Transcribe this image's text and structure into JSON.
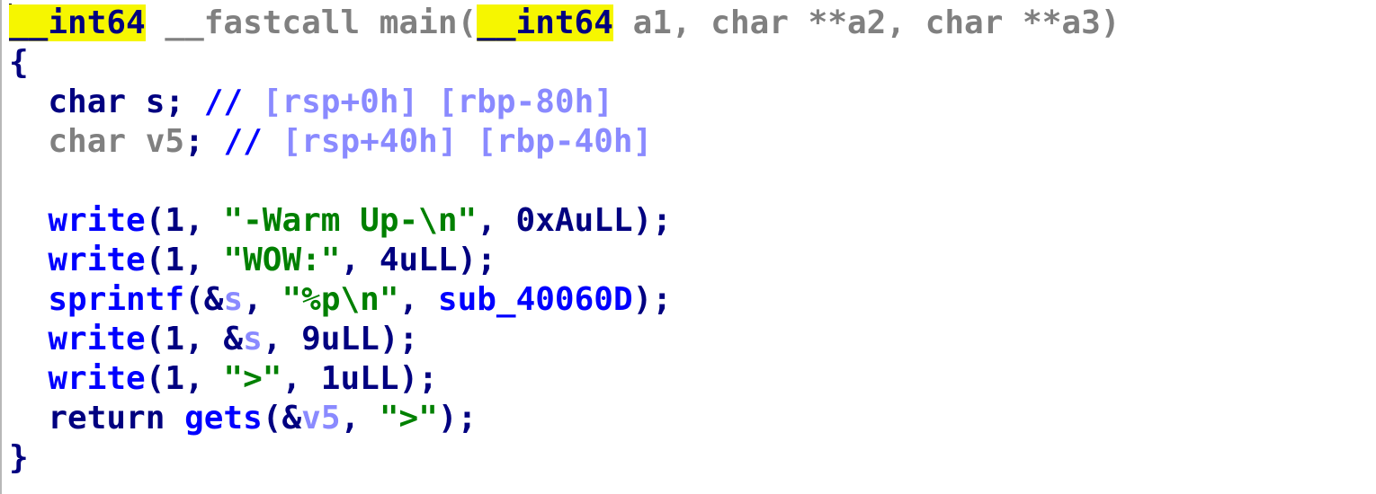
{
  "window": {
    "title": ""
  },
  "code": {
    "lines": [
      [
        {
          "t": "__int64",
          "c": "k",
          "hl": true
        },
        {
          "t": " __fastcall main(",
          "c": "g"
        },
        {
          "t": "__int64",
          "c": "k",
          "hl": true
        },
        {
          "t": " a1, char **a2, char **a3)",
          "c": "g"
        }
      ],
      [
        {
          "t": "{",
          "c": "k"
        }
      ],
      [
        {
          "t": "  char s; ",
          "c": "k"
        },
        {
          "t": "// ",
          "c": "f"
        },
        {
          "t": "[rsp+0h] [rbp-80h]",
          "c": "c"
        }
      ],
      [
        {
          "t": "  char v5",
          "c": "g"
        },
        {
          "t": "; ",
          "c": "k"
        },
        {
          "t": "// ",
          "c": "f"
        },
        {
          "t": "[rsp+40h] [rbp-40h]",
          "c": "c"
        }
      ],
      [],
      [
        {
          "t": "  write",
          "c": "f"
        },
        {
          "t": "(1, ",
          "c": "k"
        },
        {
          "t": "\"-Warm Up-\\n\"",
          "c": "s"
        },
        {
          "t": ", 0xAuLL);",
          "c": "k"
        }
      ],
      [
        {
          "t": "  write",
          "c": "f"
        },
        {
          "t": "(1, ",
          "c": "k"
        },
        {
          "t": "\"WOW:\"",
          "c": "s"
        },
        {
          "t": ", 4uLL);",
          "c": "k"
        }
      ],
      [
        {
          "t": "  sprintf",
          "c": "f"
        },
        {
          "t": "(&",
          "c": "k"
        },
        {
          "t": "s",
          "c": "c"
        },
        {
          "t": ", ",
          "c": "k"
        },
        {
          "t": "\"%p\\n\"",
          "c": "s"
        },
        {
          "t": ", ",
          "c": "k"
        },
        {
          "t": "sub_40060D",
          "c": "f"
        },
        {
          "t": ");",
          "c": "k"
        }
      ],
      [
        {
          "t": "  write",
          "c": "f"
        },
        {
          "t": "(1, &",
          "c": "k"
        },
        {
          "t": "s",
          "c": "c"
        },
        {
          "t": ", 9uLL);",
          "c": "k"
        }
      ],
      [
        {
          "t": "  write",
          "c": "f"
        },
        {
          "t": "(1, ",
          "c": "k"
        },
        {
          "t": "\">\"",
          "c": "s"
        },
        {
          "t": ", 1uLL);",
          "c": "k"
        }
      ],
      [
        {
          "t": "  return ",
          "c": "k"
        },
        {
          "t": "gets",
          "c": "f"
        },
        {
          "t": "(&",
          "c": "k"
        },
        {
          "t": "v5",
          "c": "c"
        },
        {
          "t": ", ",
          "c": "k"
        },
        {
          "t": "\">\"",
          "c": "s"
        },
        {
          "t": ");",
          "c": "k"
        }
      ],
      [
        {
          "t": "}",
          "c": "k"
        }
      ]
    ]
  }
}
